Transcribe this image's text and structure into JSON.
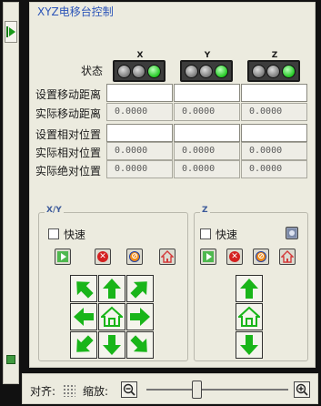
{
  "panel": {
    "title": "XYZ电移台控制"
  },
  "axes": [
    "X",
    "Y",
    "Z"
  ],
  "status": {
    "label": "状态",
    "x_leds": [
      "off",
      "off",
      "on"
    ],
    "y_leds": [
      "off",
      "off",
      "on"
    ],
    "z_leds": [
      "off",
      "off",
      "on"
    ]
  },
  "rows": [
    {
      "label": "设置移动距离",
      "kind": "input",
      "values": [
        "",
        "",
        ""
      ]
    },
    {
      "label": "实际移动距离",
      "kind": "readonly",
      "values": [
        "0.0000",
        "0.0000",
        "0.0000"
      ]
    },
    {
      "label": "设置相对位置",
      "kind": "input",
      "values": [
        "",
        "",
        ""
      ]
    },
    {
      "label": "实际相对位置",
      "kind": "readonly",
      "values": [
        "0.0000",
        "0.0000",
        "0.0000"
      ]
    },
    {
      "label": "实际绝对位置",
      "kind": "readonly",
      "values": [
        "0.0000",
        "0.0000",
        "0.0000"
      ]
    }
  ],
  "xy_group": {
    "title": "X/Y",
    "fast_label": "快速",
    "fast_checked": false
  },
  "z_group": {
    "title": "Z",
    "fast_label": "快速",
    "fast_checked": false
  },
  "control_icons": [
    "play-icon",
    "stop-icon",
    "disable-icon",
    "home-icon"
  ],
  "colors": {
    "title": "#2c55b8",
    "arrow_green": "#19b519",
    "led_on": "#22c722"
  },
  "statusbar": {
    "align_label": "对齐:",
    "zoom_label": "缩放:",
    "zoom_level": 0.35
  }
}
